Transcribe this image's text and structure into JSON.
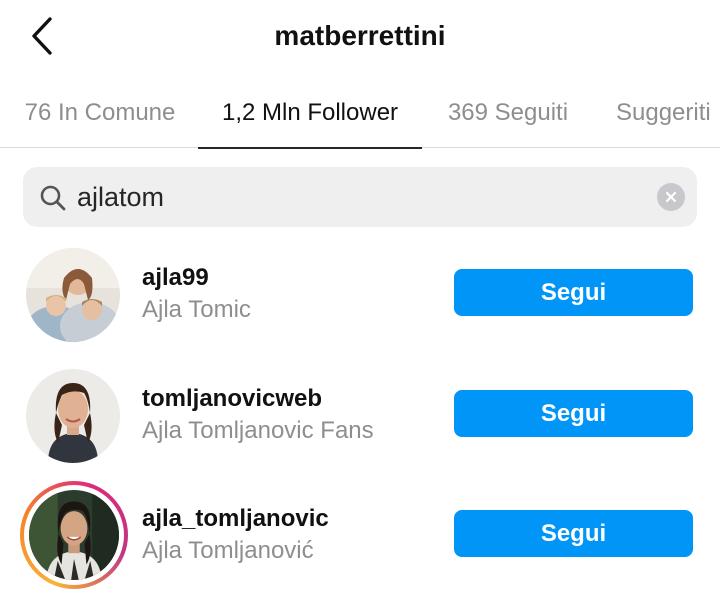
{
  "header": {
    "title": "matberrettini",
    "back_icon": "chevron-left-icon"
  },
  "tabs": [
    {
      "label": "76 In Comune",
      "active": false
    },
    {
      "label": "1,2 Mln Follower",
      "active": true
    },
    {
      "label": "369 Seguiti",
      "active": false
    },
    {
      "label": "Suggeriti",
      "active": false
    }
  ],
  "search": {
    "value": "ajlatom",
    "icon": "search-icon",
    "clear_icon": "clear-icon"
  },
  "results": [
    {
      "username": "ajla99",
      "full_name": "Ajla Tomic",
      "button_label": "Segui",
      "has_story": false
    },
    {
      "username": "tomljanovicweb",
      "full_name": "Ajla Tomljanovic Fans",
      "button_label": "Segui",
      "has_story": false
    },
    {
      "username": "ajla_tomljanovic",
      "full_name": "Ajla Tomljanović",
      "button_label": "Segui",
      "has_story": true
    }
  ],
  "colors": {
    "follow_button": "#0095f6",
    "active_tab_underline": "#262626",
    "muted_text": "#8e8e8e"
  }
}
